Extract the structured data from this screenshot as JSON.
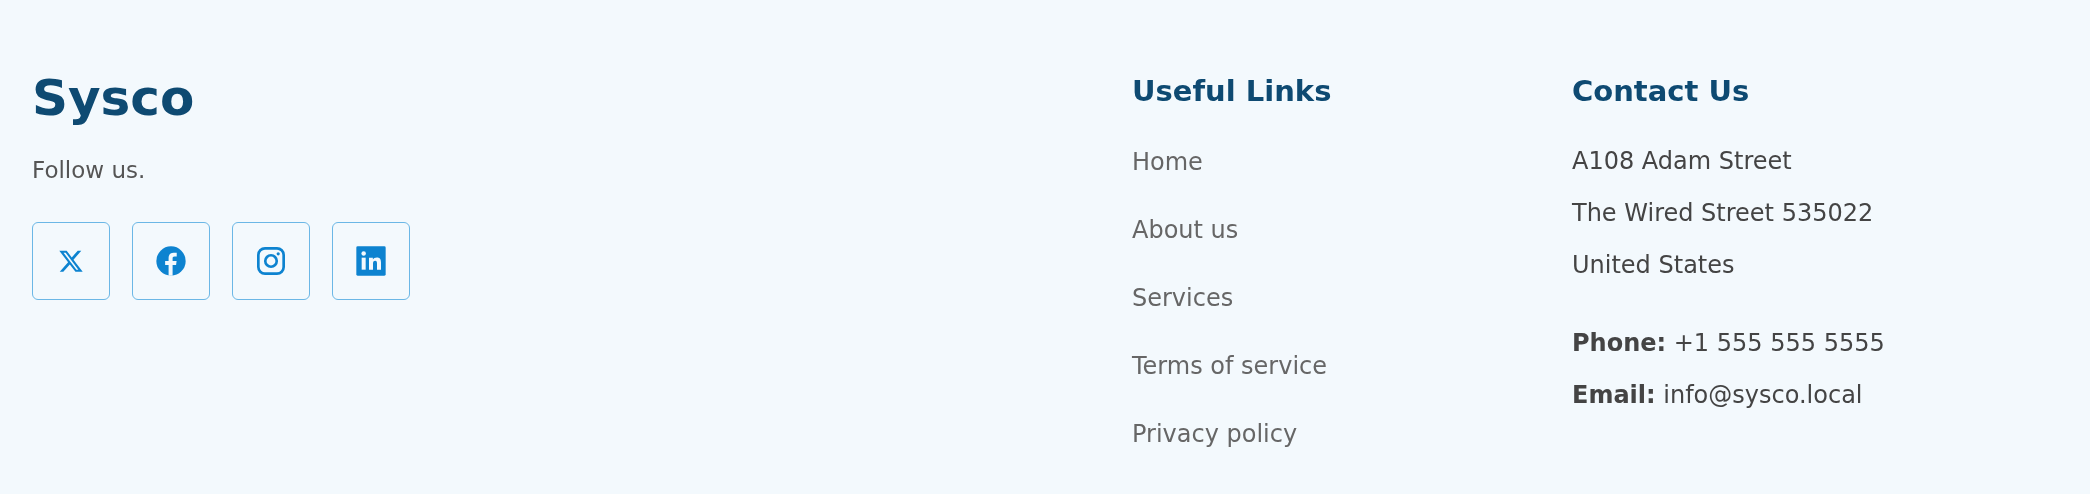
{
  "brand": {
    "logo": "Sysco",
    "tagline": "Follow us.",
    "social": [
      {
        "kind": "x"
      },
      {
        "kind": "facebook"
      },
      {
        "kind": "instagram"
      },
      {
        "kind": "linkedin"
      }
    ]
  },
  "useful_links": {
    "title": "Useful Links",
    "items": [
      "Home",
      "About us",
      "Services",
      "Terms of service",
      "Privacy policy"
    ]
  },
  "contact": {
    "title": "Contact Us",
    "address": [
      "A108 Adam Street",
      "The Wired Street 535022",
      "United States"
    ],
    "details": [
      "**Phone:** +1 555 555 5555",
      "**Email:** info@sysco.local"
    ]
  }
}
